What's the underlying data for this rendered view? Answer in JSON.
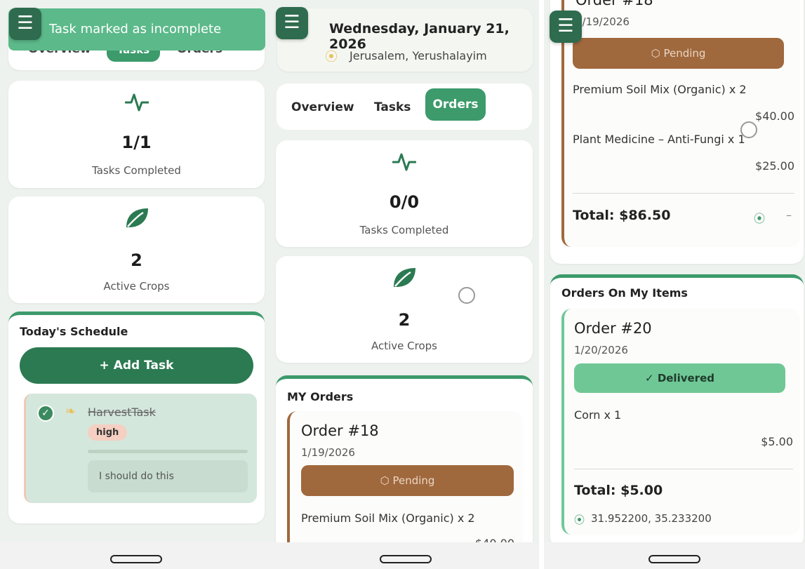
{
  "menu_icon": "hamburger-icon",
  "panel1": {
    "toast": "Task marked as incomplete",
    "tabs_partial": [
      "Overview",
      "Tasks",
      "Orders"
    ],
    "stats": [
      {
        "icon": "activity-icon",
        "value": "1/1",
        "label": "Tasks Completed"
      },
      {
        "icon": "leaf-icon",
        "value": "2",
        "label": "Active Crops"
      }
    ],
    "schedule": {
      "title": "Today's Schedule",
      "add_task": "+ Add Task",
      "task": {
        "name": "HarvestTask",
        "priority": "high",
        "note": "I should do this",
        "completed": true
      }
    }
  },
  "panel2": {
    "date": "Wednesday, January 21, 2026",
    "location": "Jerusalem, Yerushalayim",
    "tabs": [
      "Overview",
      "Tasks",
      "Orders"
    ],
    "active_tab": "Orders",
    "stats": [
      {
        "icon": "activity-icon",
        "value": "0/0",
        "label": "Tasks Completed"
      },
      {
        "icon": "leaf-icon",
        "value": "2",
        "label": "Active Crops"
      }
    ],
    "my_orders_title": "MY Orders",
    "order": {
      "title": "Order #18",
      "date": "1/19/2026",
      "status": "Pending",
      "item": "Premium Soil Mix (Organic) x 2",
      "price_partial": "$40.00"
    }
  },
  "panel3": {
    "order_partial_title": "Order #18",
    "order_partial_date": "1/19/2026",
    "status": "Pending",
    "items": [
      {
        "name": "Premium Soil Mix (Organic) x 2",
        "price": "$40.00"
      },
      {
        "name": "Plant Medicine – Anti-Fungi x 1",
        "price": "$25.00"
      }
    ],
    "total": "Total: $86.50",
    "location_dash": "–",
    "orders_on_items_title": "Orders On My Items",
    "order2": {
      "title": "Order #20",
      "date": "1/20/2026",
      "status": "Delivered",
      "item": "Corn x 1",
      "price": "$5.00",
      "total": "Total: $5.00",
      "coords": "31.952200, 35.233200"
    }
  },
  "colors": {
    "green": "#2b7a52",
    "brown": "#a0683d",
    "mint": "#6fc796"
  }
}
